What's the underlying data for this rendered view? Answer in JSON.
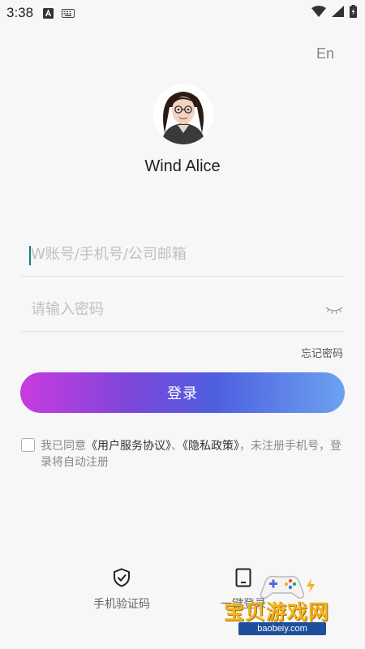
{
  "status_bar": {
    "time": "3:38"
  },
  "language_toggle": "En",
  "profile": {
    "name": "Wind Alice"
  },
  "login_form": {
    "account_placeholder": "W账号/手机号/公司邮箱",
    "password_placeholder": "请输入密码",
    "forgot_password": "忘记密码",
    "login_button": "登录"
  },
  "agreement": {
    "prefix": "我已同意",
    "terms_link": "《用户服务协议》",
    "separator": "、",
    "privacy_link": "《隐私政策》",
    "suffix": "，未注册手机号，登录将自动注册"
  },
  "alternate_logins": [
    {
      "label": "手机验证码",
      "icon": "shield-check-icon"
    },
    {
      "label": "一键登录",
      "icon": "phone-icon"
    }
  ],
  "watermark": {
    "title": "宝贝游戏网",
    "url": "baobeiy.com"
  },
  "colors": {
    "background": "#f7f7f7",
    "gradient_start": "#c93be0",
    "gradient_end": "#6ba2ef",
    "cursor": "#1d7a7a"
  }
}
